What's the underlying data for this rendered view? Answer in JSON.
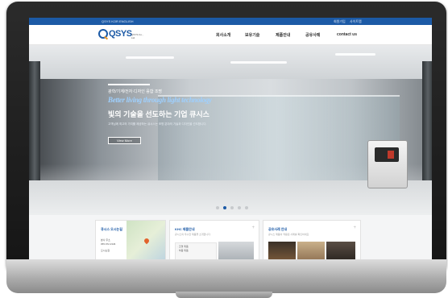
{
  "topbar": {
    "left_items": [
      "QSYS KOR",
      "ENGLISH"
    ],
    "right_items": [
      "회원가입",
      "사이트맵"
    ]
  },
  "header": {
    "logo_text": "QSYS",
    "logo_sub": "QSYS Co., Ltd.",
    "menu": [
      "회사소개",
      "보유기술",
      "제품안내",
      "공유사례",
      "contact us"
    ]
  },
  "hero": {
    "small_text": "광학/기계/전자·디자인 융합 조명",
    "english_tagline": "Better living through light technology",
    "korean_headline": "빛의 기술을 선도하는 기업 큐시스",
    "description": "고객님께 최고의 가치를 제공하는 큐시스는 조명 분야의 기술과 디자인을 선도합니다.",
    "button_label": "View More",
    "slides_total": 5,
    "active_slide": 2
  },
  "cards": [
    {
      "title": "큐시스 오시는길",
      "lines": [
        "본사 주소",
        "055.972.2346",
        "오시는길"
      ]
    },
    {
      "title": "KHC 제품안내",
      "description": "큐시스의 우수한 제품을 소개합니다.",
      "list": [
        "· 조명 제품",
        "· 부품 제품"
      ]
    },
    {
      "title": "공유사례 안내",
      "description": "큐시스 제품이 적용된 사례를 확인하세요."
    }
  ],
  "colors": {
    "brand_blue": "#1c5aa6",
    "accent_orange": "#e8962b",
    "tagline_blue": "#9ed0ff"
  }
}
